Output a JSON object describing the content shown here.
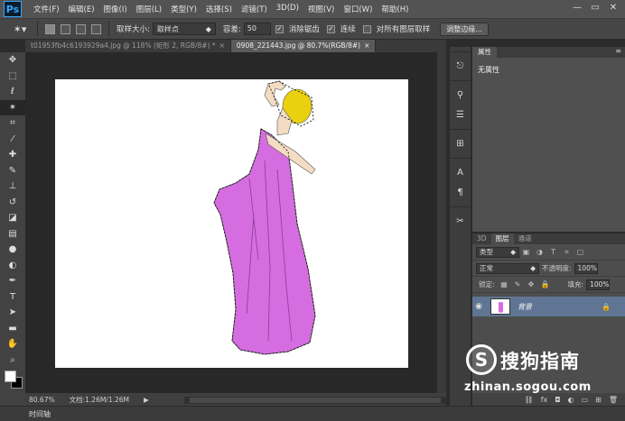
{
  "app": {
    "logo": "Ps",
    "menu": [
      "文件(F)",
      "编辑(E)",
      "图像(I)",
      "图层(L)",
      "类型(Y)",
      "选择(S)",
      "滤镜(T)",
      "3D(D)",
      "视图(V)",
      "窗口(W)",
      "帮助(H)"
    ],
    "window_controls": {
      "minimize": "—",
      "restore": "▭",
      "close": "✕"
    }
  },
  "options": {
    "sample_size_label": "取样大小:",
    "sample_size_value": "取样点",
    "tolerance_label": "容差:",
    "tolerance_value": "50",
    "antialias_label": "消除锯齿",
    "antialias_checked": true,
    "contiguous_label": "连续",
    "contiguous_checked": true,
    "all_layers_label": "对所有图层取样",
    "all_layers_checked": false,
    "refine_edge_label": "调整边缘..."
  },
  "tabs": [
    {
      "label": "t01953fb4c6193929a4.jpg @ 118% (矩形 2, RGB/8#) *",
      "active": false
    },
    {
      "label": "0908_221443.jpg @ 80.7%(RGB/8#)",
      "active": true
    }
  ],
  "status": {
    "zoom": "80.67%",
    "doc_size": "文档:1.26M/1.26M",
    "arrow": "▶"
  },
  "timeline": {
    "label": "时间轴"
  },
  "properties": {
    "tab": "属性",
    "body": "无属性"
  },
  "layers": {
    "tabs": [
      "3D",
      "图层",
      "通道"
    ],
    "active_tab": "图层",
    "filter_label": "类型",
    "blend_mode": "正常",
    "opacity_label": "不透明度:",
    "opacity_value": "100%",
    "lock_label": "锁定:",
    "fill_label": "填充:",
    "fill_value": "100%",
    "layer_name": "背景"
  },
  "watermark": {
    "logo_letter": "S",
    "brand": "搜狗指南",
    "url": "zhinan.sogou.com"
  },
  "colors": {
    "dress": "#d56de0",
    "hair": "#ead10f",
    "layer_selected": "#5f7593"
  }
}
